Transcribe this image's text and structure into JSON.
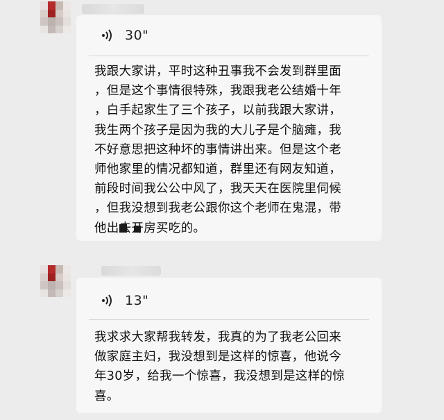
{
  "messages": [
    {
      "duration": "30\"",
      "text_lines": [
        "我跟大家讲，平时这种丑事我不会发到群里面",
        "，但是这个事情很特殊，我跟我老公结婚十年",
        "，白手起家生了三个孩子，以前我跟大家讲，",
        "我生两个孩子是因为我的大儿子是个脑瘫，我",
        "不好意思把这种坏的事情讲出来。但是这个老",
        "师他家里的情况都知道，群里还有网友知道，",
        "前段时间我公公中风了，我天天在医院里伺候",
        "，但我没想到我老公跟你这个老师在鬼混，带",
        "他出去开房买吃的。"
      ]
    },
    {
      "duration": "13\"",
      "text_lines": [
        "我求求大家帮我转发，我真的为了我老公回来",
        "做家庭主妇，我没想到是这样的惊喜，他说今",
        "年30岁，给我一个惊喜，我没想到是这样的惊",
        "喜。"
      ]
    }
  ],
  "icons": {
    "voice": "voice-message-icon",
    "avatar": "blurred-avatar"
  },
  "colors": {
    "background": "#ececec",
    "bubble": "#f7f7f7",
    "text": "#111111"
  }
}
